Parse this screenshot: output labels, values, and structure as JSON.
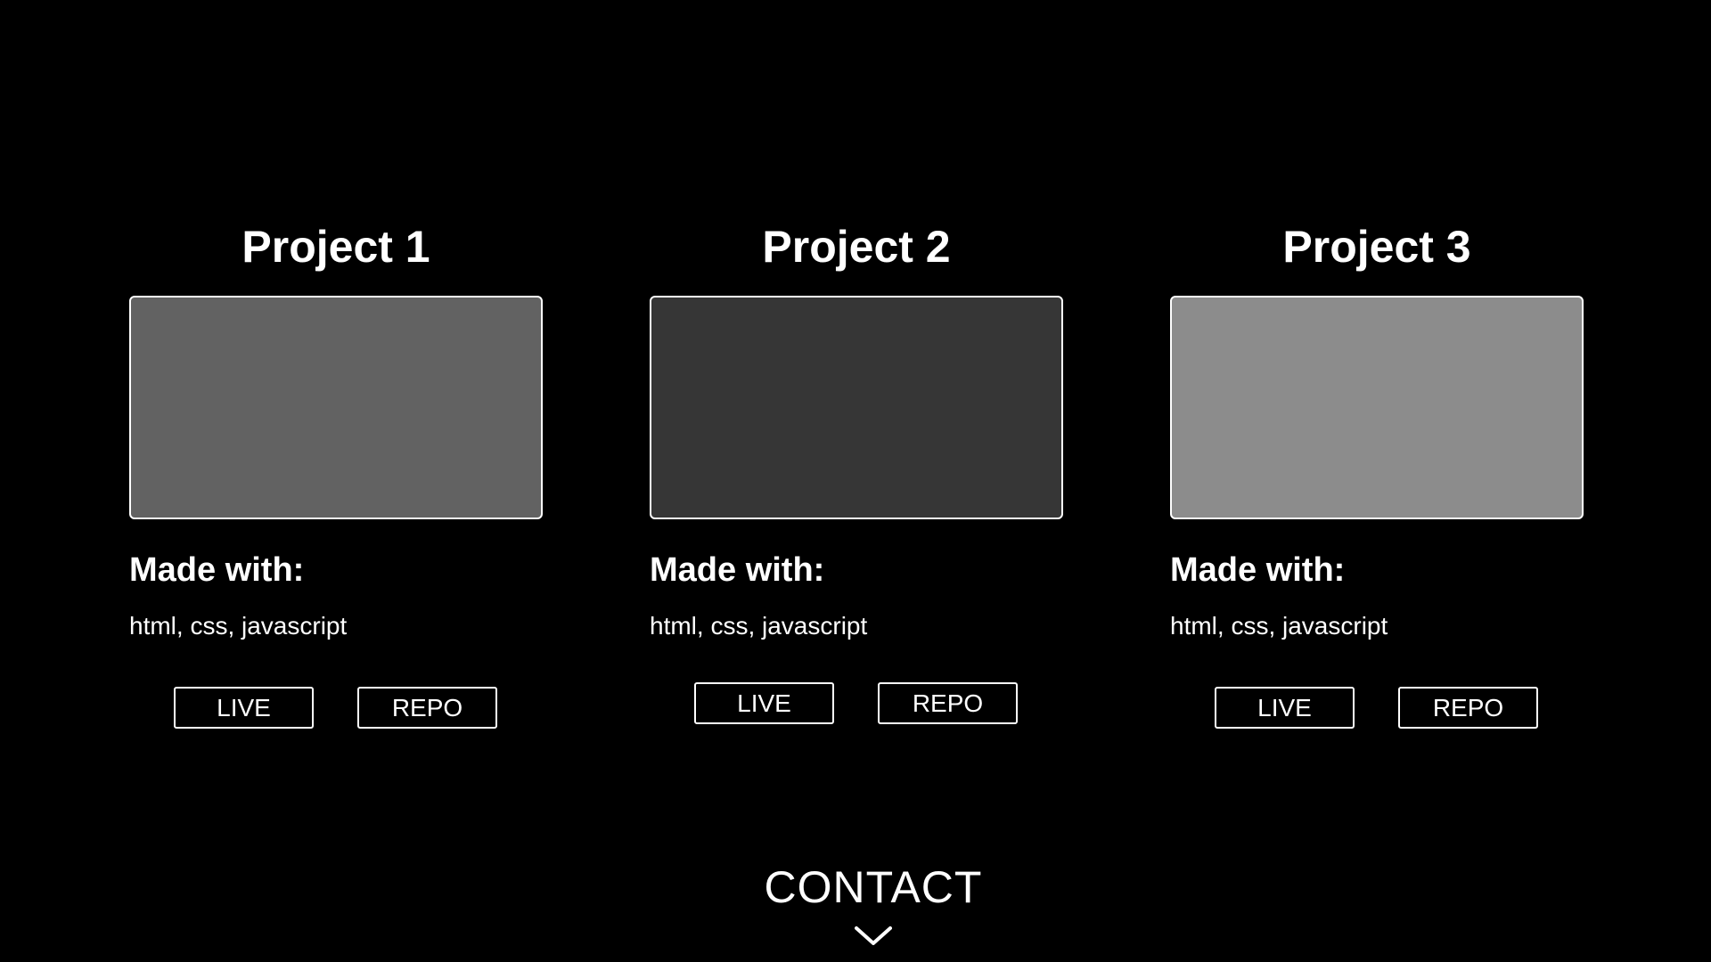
{
  "projects": [
    {
      "title": "Project 1",
      "thumbnail_color": "#626262",
      "made_with_label": "Made with:",
      "stack": "html, css, javascript",
      "live_label": "LIVE",
      "repo_label": "REPO"
    },
    {
      "title": "Project 2",
      "thumbnail_color": "#363636",
      "made_with_label": "Made with:",
      "stack": "html, css, javascript",
      "live_label": "LIVE",
      "repo_label": "REPO"
    },
    {
      "title": "Project 3",
      "thumbnail_color": "#8c8c8c",
      "made_with_label": "Made with:",
      "stack": "html, css, javascript",
      "live_label": "LIVE",
      "repo_label": "REPO"
    }
  ],
  "contact": {
    "label": "CONTACT",
    "icon": "chevron-down-icon"
  },
  "colors": {
    "background": "#000000",
    "text": "#ffffff",
    "border": "#ffffff"
  }
}
